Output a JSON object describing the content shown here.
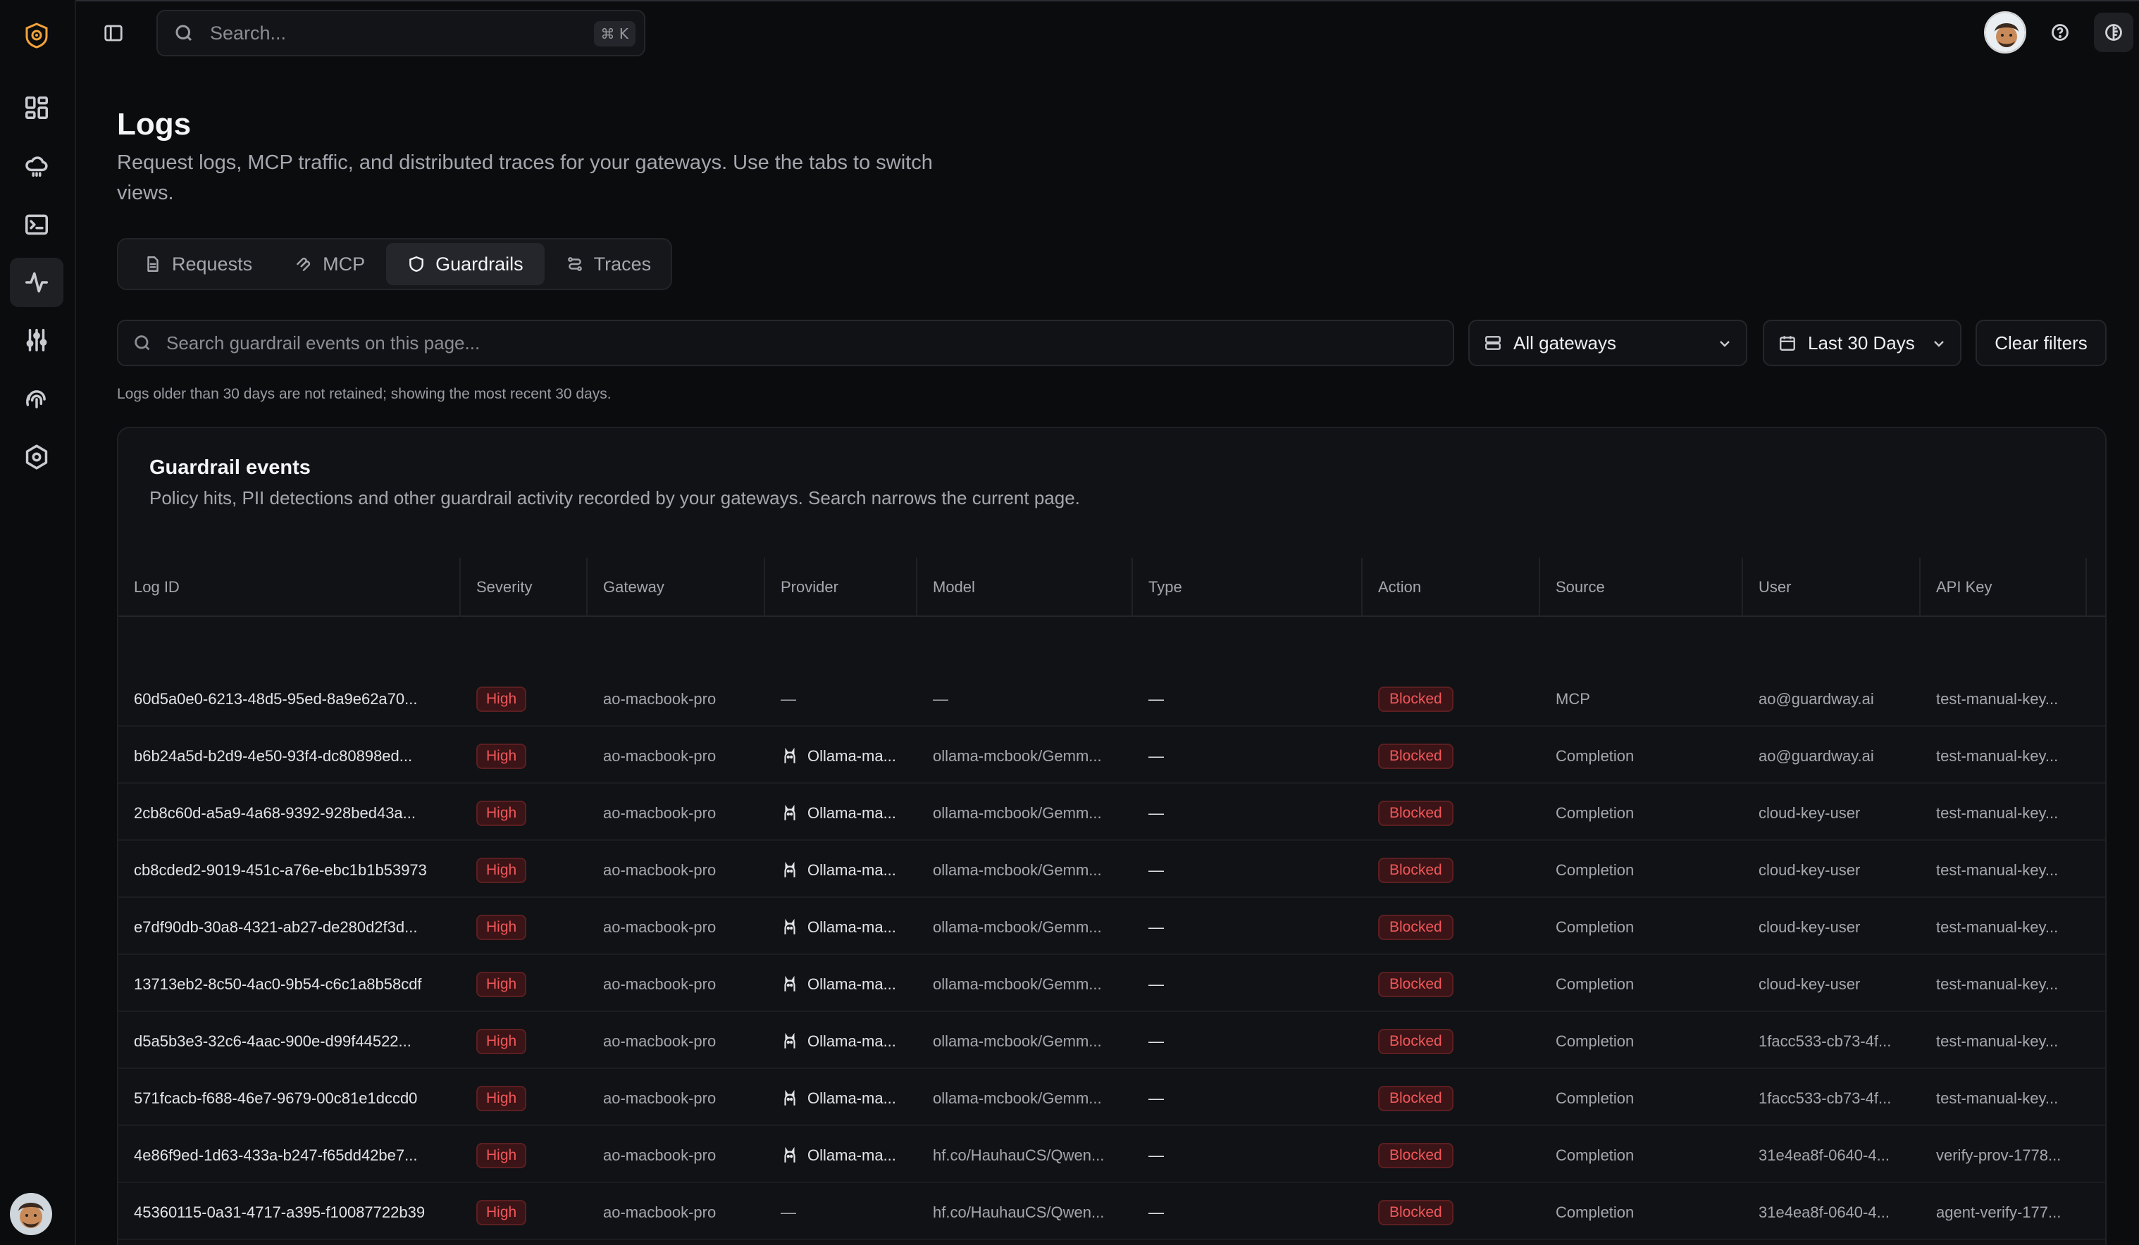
{
  "topbar": {
    "search_placeholder": "Search...",
    "shortcut": "⌘ K"
  },
  "page": {
    "title": "Logs",
    "description": "Request logs, MCP traffic, and distributed traces for your gateways. Use the tabs to switch views."
  },
  "tabs": [
    {
      "label": "Requests",
      "icon": "file-icon"
    },
    {
      "label": "MCP",
      "icon": "mcp-icon"
    },
    {
      "label": "Guardrails",
      "icon": "shield-icon",
      "active": true
    },
    {
      "label": "Traces",
      "icon": "traces-icon"
    }
  ],
  "filters": {
    "search_placeholder": "Search guardrail events on this page...",
    "gateway": "All gateways",
    "date_range": "Last 30 Days",
    "clear": "Clear filters",
    "retention_note": "Logs older than 30 days are not retained; showing the most recent 30 days."
  },
  "card": {
    "title": "Guardrail events",
    "description": "Policy hits, PII detections and other guardrail activity recorded by your gateways. Search narrows the current page."
  },
  "table": {
    "columns": [
      "Log ID",
      "Severity",
      "Gateway",
      "Provider",
      "Model",
      "Type",
      "Action",
      "Source",
      "User",
      "API Key"
    ],
    "rows": [
      {
        "id": "60d5a0e0-6213-48d5-95ed-8a9e62a70...",
        "severity": "High",
        "gateway": "ao-macbook-pro",
        "provider": "—",
        "provider_icon": false,
        "model": "—",
        "type": "—",
        "action": "Blocked",
        "source": "MCP",
        "user": "ao@guardway.ai",
        "api_key": "test-manual-key..."
      },
      {
        "id": "b6b24a5d-b2d9-4e50-93f4-dc80898ed...",
        "severity": "High",
        "gateway": "ao-macbook-pro",
        "provider": "Ollama-ma...",
        "provider_icon": true,
        "model": "ollama-mcbook/Gemm...",
        "type": "—",
        "action": "Blocked",
        "source": "Completion",
        "user": "ao@guardway.ai",
        "api_key": "test-manual-key..."
      },
      {
        "id": "2cb8c60d-a5a9-4a68-9392-928bed43a...",
        "severity": "High",
        "gateway": "ao-macbook-pro",
        "provider": "Ollama-ma...",
        "provider_icon": true,
        "model": "ollama-mcbook/Gemm...",
        "type": "—",
        "action": "Blocked",
        "source": "Completion",
        "user": "cloud-key-user",
        "api_key": "test-manual-key..."
      },
      {
        "id": "cb8cded2-9019-451c-a76e-ebc1b1b53973",
        "severity": "High",
        "gateway": "ao-macbook-pro",
        "provider": "Ollama-ma...",
        "provider_icon": true,
        "model": "ollama-mcbook/Gemm...",
        "type": "—",
        "action": "Blocked",
        "source": "Completion",
        "user": "cloud-key-user",
        "api_key": "test-manual-key..."
      },
      {
        "id": "e7df90db-30a8-4321-ab27-de280d2f3d...",
        "severity": "High",
        "gateway": "ao-macbook-pro",
        "provider": "Ollama-ma...",
        "provider_icon": true,
        "model": "ollama-mcbook/Gemm...",
        "type": "—",
        "action": "Blocked",
        "source": "Completion",
        "user": "cloud-key-user",
        "api_key": "test-manual-key..."
      },
      {
        "id": "13713eb2-8c50-4ac0-9b54-c6c1a8b58cdf",
        "severity": "High",
        "gateway": "ao-macbook-pro",
        "provider": "Ollama-ma...",
        "provider_icon": true,
        "model": "ollama-mcbook/Gemm...",
        "type": "—",
        "action": "Blocked",
        "source": "Completion",
        "user": "cloud-key-user",
        "api_key": "test-manual-key..."
      },
      {
        "id": "d5a5b3e3-32c6-4aac-900e-d99f44522...",
        "severity": "High",
        "gateway": "ao-macbook-pro",
        "provider": "Ollama-ma...",
        "provider_icon": true,
        "model": "ollama-mcbook/Gemm...",
        "type": "—",
        "action": "Blocked",
        "source": "Completion",
        "user": "1facc533-cb73-4f...",
        "api_key": "test-manual-key..."
      },
      {
        "id": "571fcacb-f688-46e7-9679-00c81e1dccd0",
        "severity": "High",
        "gateway": "ao-macbook-pro",
        "provider": "Ollama-ma...",
        "provider_icon": true,
        "model": "ollama-mcbook/Gemm...",
        "type": "—",
        "action": "Blocked",
        "source": "Completion",
        "user": "1facc533-cb73-4f...",
        "api_key": "test-manual-key..."
      },
      {
        "id": "4e86f9ed-1d63-433a-b247-f65dd42be7...",
        "severity": "High",
        "gateway": "ao-macbook-pro",
        "provider": "Ollama-ma...",
        "provider_icon": true,
        "model": "hf.co/HauhauCS/Qwen...",
        "type": "—",
        "action": "Blocked",
        "source": "Completion",
        "user": "31e4ea8f-0640-4...",
        "api_key": "verify-prov-1778..."
      },
      {
        "id": "45360115-0a31-4717-a395-f10087722b39",
        "severity": "High",
        "gateway": "ao-macbook-pro",
        "provider": "—",
        "provider_icon": false,
        "model": "hf.co/HauhauCS/Qwen...",
        "type": "—",
        "action": "Blocked",
        "source": "Completion",
        "user": "31e4ea8f-0640-4...",
        "api_key": "agent-verify-177..."
      }
    ]
  },
  "colors": {
    "background": "#0b0c0e",
    "accent_orange": "#f2a33a",
    "danger": "#f0575b"
  }
}
